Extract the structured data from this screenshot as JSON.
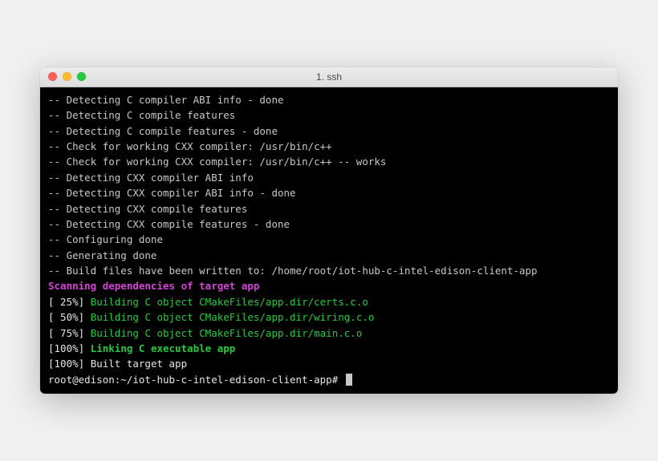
{
  "window": {
    "title": "1. ssh"
  },
  "lines": {
    "l0": "-- Detecting C compiler ABI info - done",
    "l1": "-- Detecting C compile features",
    "l2": "-- Detecting C compile features - done",
    "l3": "-- Check for working CXX compiler: /usr/bin/c++",
    "l4": "-- Check for working CXX compiler: /usr/bin/c++ -- works",
    "l5": "-- Detecting CXX compiler ABI info",
    "l6": "-- Detecting CXX compiler ABI info - done",
    "l7": "-- Detecting CXX compile features",
    "l8": "-- Detecting CXX compile features - done",
    "l9": "-- Configuring done",
    "l10": "-- Generating done",
    "l11": "-- Build files have been written to: /home/root/iot-hub-c-intel-edison-client-app",
    "scan": "Scanning dependencies of target app",
    "p25": "[ 25%] ",
    "p50": "[ 50%] ",
    "p75": "[ 75%] ",
    "p100a": "[100%] ",
    "p100b": "[100%] ",
    "b25": "Building C object CMakeFiles/app.dir/certs.c.o",
    "b50": "Building C object CMakeFiles/app.dir/wiring.c.o",
    "b75": "Building C object CMakeFiles/app.dir/main.c.o",
    "link": "Linking C executable app",
    "built": "Built target app",
    "prompt": "root@edison:~/iot-hub-c-intel-edison-client-app# "
  }
}
